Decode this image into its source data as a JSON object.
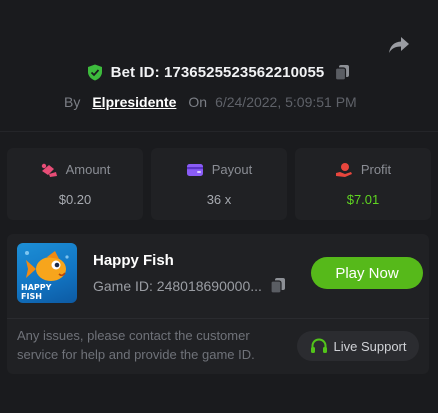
{
  "header": {
    "bet_label": "Bet ID: 1736525523562210055",
    "by_label": "By",
    "username": "Elpresidente",
    "on_label": "On",
    "datetime": "6/24/2022, 5:09:51 PM"
  },
  "stats": [
    {
      "label": "Amount",
      "value": "$0.20",
      "icon": "amount-icon"
    },
    {
      "label": "Payout",
      "value": "36 x",
      "icon": "wallet-icon"
    },
    {
      "label": "Profit",
      "value": "$7.01",
      "icon": "profit-icon"
    }
  ],
  "game": {
    "title": "Happy Fish",
    "game_id": "Game ID: 248018690000...",
    "thumb_text": "HAPPY FISH",
    "play_label": "Play Now"
  },
  "support": {
    "message": "Any issues, please contact the customer service for help and provide the game ID.",
    "button_label": "Live Support"
  },
  "colors": {
    "background": "#1a1b1e",
    "card": "#202124",
    "accent_green": "#56b91a",
    "profit_green": "#5fd421",
    "shield_green": "#3dbb3d",
    "amount_pink": "#e84d77",
    "payout_purple": "#8a5cf6",
    "profit_red": "#e8463d"
  }
}
